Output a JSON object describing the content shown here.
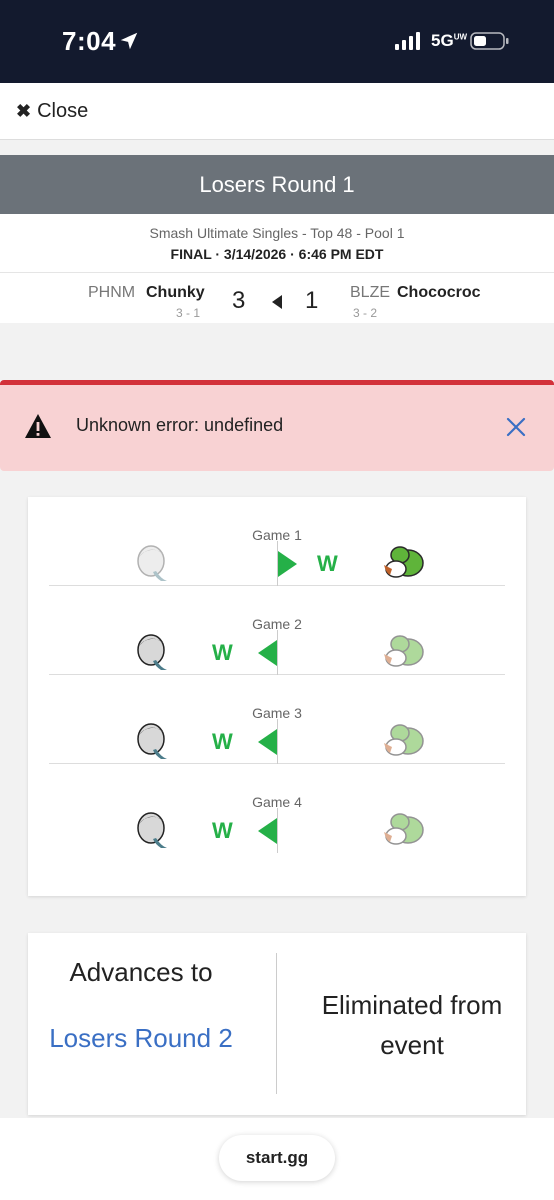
{
  "status_bar": {
    "time": "7:04",
    "network": "5G",
    "network_sup": "UW"
  },
  "close": {
    "label": "Close"
  },
  "round": {
    "title": "Losers Round 1"
  },
  "meta": {
    "event": "Smash Ultimate Singles - Top 48 - Pool 1",
    "status_line": "FINAL · 3/14/2026 · 6:46 PM EDT"
  },
  "players": {
    "p1": {
      "tag": "PHNM",
      "name": "Chunky",
      "record": "3 - 1",
      "score": "3"
    },
    "p2": {
      "tag": "BLZE",
      "name": "Chococroc",
      "record": "3 - 2",
      "score": "1"
    }
  },
  "error": {
    "message": "Unknown error: undefined"
  },
  "games": [
    {
      "label": "Game 1",
      "winner": "right",
      "win_mark": "W"
    },
    {
      "label": "Game 2",
      "winner": "left",
      "win_mark": "W"
    },
    {
      "label": "Game 3",
      "winner": "left",
      "win_mark": "W"
    },
    {
      "label": "Game 4",
      "winner": "left",
      "win_mark": "W"
    }
  ],
  "advance": {
    "title": "Advances to",
    "link": "Losers Round 2",
    "eliminated": "Eliminated from event"
  },
  "bottom": {
    "site": "start.gg"
  },
  "colors": {
    "accent_green": "#25b048",
    "link_blue": "#3a6fc4",
    "error_red": "#d3313a",
    "header_gray": "#6b7279"
  }
}
